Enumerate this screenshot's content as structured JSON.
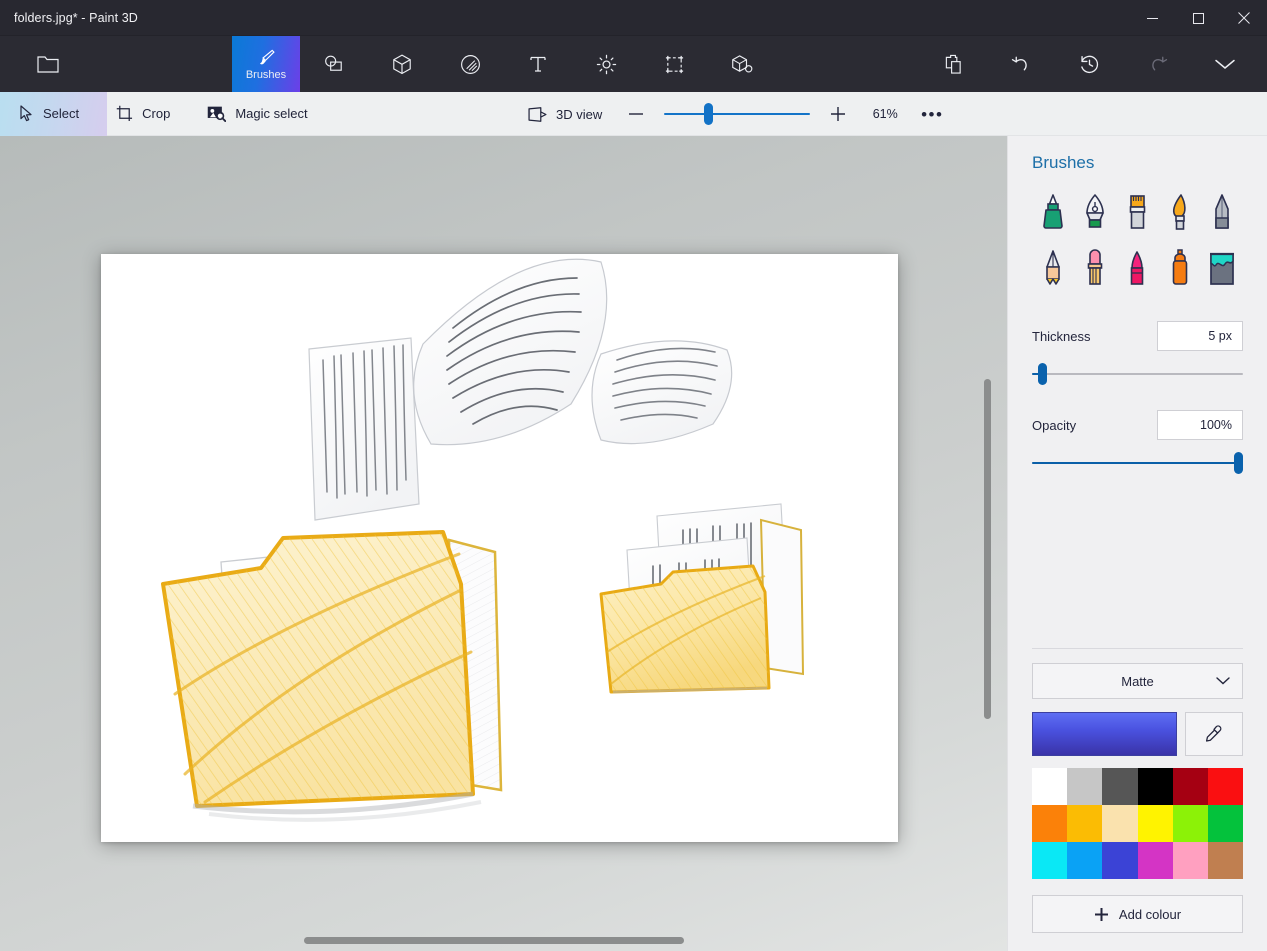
{
  "window": {
    "title": "folders.jpg* - Paint 3D",
    "controls": [
      {
        "name": "minimize",
        "glyph": "minimize-icon"
      },
      {
        "name": "maximize",
        "glyph": "maximize-icon"
      },
      {
        "name": "close",
        "glyph": "close-icon"
      }
    ]
  },
  "ribbon": {
    "menu_label": "Menu",
    "tabs": [
      {
        "id": "menu",
        "label": "",
        "icon": "folder-icon",
        "active": false,
        "disabled": false
      },
      {
        "id": "brushes",
        "label": "Brushes",
        "icon": "brush-icon",
        "active": true,
        "disabled": false
      },
      {
        "id": "shapes2d",
        "label": "",
        "icon": "2d-shapes-icon",
        "active": false,
        "disabled": false
      },
      {
        "id": "shapes3d",
        "label": "",
        "icon": "3d-shapes-icon",
        "active": false,
        "disabled": false
      },
      {
        "id": "stickers",
        "label": "",
        "icon": "stickers-icon",
        "active": false,
        "disabled": false
      },
      {
        "id": "text",
        "label": "",
        "icon": "text-icon",
        "active": false,
        "disabled": false
      },
      {
        "id": "effects",
        "label": "",
        "icon": "effects-icon",
        "active": false,
        "disabled": false
      },
      {
        "id": "canvas",
        "label": "",
        "icon": "canvas-icon",
        "active": false,
        "disabled": false
      },
      {
        "id": "library3d",
        "label": "",
        "icon": "3d-library-icon",
        "active": false,
        "disabled": false
      }
    ],
    "right_tools": [
      {
        "id": "clipboard",
        "icon": "clipboard-icon",
        "disabled": false
      },
      {
        "id": "undo",
        "icon": "undo-icon",
        "disabled": false
      },
      {
        "id": "history",
        "icon": "history-icon",
        "disabled": false
      },
      {
        "id": "redo",
        "icon": "redo-icon",
        "disabled": true
      },
      {
        "id": "expand",
        "icon": "chevron-down-icon",
        "disabled": false
      }
    ]
  },
  "subbar": {
    "select_label": "Select",
    "crop_label": "Crop",
    "magic_select_label": "Magic select",
    "view_3d_label": "3D view",
    "zoom_out_label": "−",
    "zoom_in_label": "+",
    "zoom_percent": "61%",
    "more_label": "•••"
  },
  "panel": {
    "title": "Brushes",
    "brushes": [
      {
        "id": "marker",
        "name": "marker-brush"
      },
      {
        "id": "calligraphy-pen",
        "name": "calligraphy-pen-brush"
      },
      {
        "id": "oil-brush",
        "name": "oil-brush"
      },
      {
        "id": "watercolour",
        "name": "watercolour-brush"
      },
      {
        "id": "pixel-pen",
        "name": "pixel-pen-brush"
      },
      {
        "id": "pencil",
        "name": "pencil-brush"
      },
      {
        "id": "eraser",
        "name": "eraser-brush"
      },
      {
        "id": "crayon",
        "name": "crayon-brush"
      },
      {
        "id": "spray-can",
        "name": "spray-can-brush"
      },
      {
        "id": "fill",
        "name": "fill-tool"
      }
    ],
    "thickness": {
      "label": "Thickness",
      "value": "5 px",
      "percent": 4
    },
    "opacity": {
      "label": "Opacity",
      "value": "100%",
      "percent": 100
    },
    "material": {
      "label": "Matte"
    },
    "current_colour": "#4a52e0",
    "eyedropper_name": "eyedropper-icon",
    "palette": [
      "#ffffff",
      "#c6c6c6",
      "#565656",
      "#000000",
      "#a50012",
      "#fa0f11",
      "#fb8109",
      "#fbbc04",
      "#fae2ae",
      "#fff300",
      "#8cf207",
      "#04c23c",
      "#0ae8f5",
      "#0aa2f5",
      "#3b43d6",
      "#d434c5",
      "#ffa0c0",
      "#c07f50"
    ],
    "add_colour_label": "Add colour"
  },
  "canvas": {
    "zoom_percent": "61%",
    "artwork_description": "pencil-sketch-of-documents-and-folders"
  }
}
